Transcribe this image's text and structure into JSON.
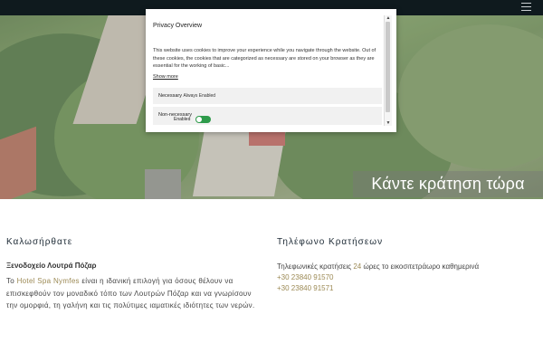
{
  "hero": {
    "cta_label": "Κάντε κράτηση τώρα"
  },
  "welcome": {
    "title": "Καλωσήρθατε",
    "subtitle": "Ξενοδοχείο Λουτρά Πόζαρ",
    "para_prefix": "Το ",
    "para_accent": "Hotel Spa Nymfes",
    "para_rest": " είναι η ιδανική επιλογή για όσους θέλουν να επισκεφθούν τον μοναδικό τόπο των Λουτρών Πόζαρ και να γνωρίσουν την ομορφιά, τη γαλήνη και τις πολύτιμες ιαματικές ιδιότητες των νερών."
  },
  "booking": {
    "title": "Τηλέφωνο Κρατήσεων",
    "line_prefix": "Τηλεφωνικές κρατήσεις ",
    "line_accent": "24",
    "line_rest": " ώρες το εικοσιτετράωρο καθημερινά",
    "phones": [
      "+30 23840 91570",
      "+30 23840 91571"
    ]
  },
  "privacy": {
    "title": "Privacy Overview",
    "close": "✕",
    "text": "This website uses cookies to improve your experience while you navigate through the website. Out of these cookies, the cookies that are categorized as necessary are stored on your browser as they are essential for the working of basic...",
    "show_more": "Show more",
    "necessary_label": "Necessary",
    "necessary_status": "Always Enabled",
    "non_necessary_label": "Non-necessary",
    "non_necessary_toggle": "Enabled",
    "non_necessary_enabled": true
  },
  "colors": {
    "topbar": "#0f1a1e",
    "accent": "#9c8a55",
    "toggle_on": "#2e9b4b"
  },
  "icons": {
    "menu": "hamburger-icon",
    "scroll_up": "arrow-up-icon",
    "scroll_down": "arrow-down-icon"
  }
}
